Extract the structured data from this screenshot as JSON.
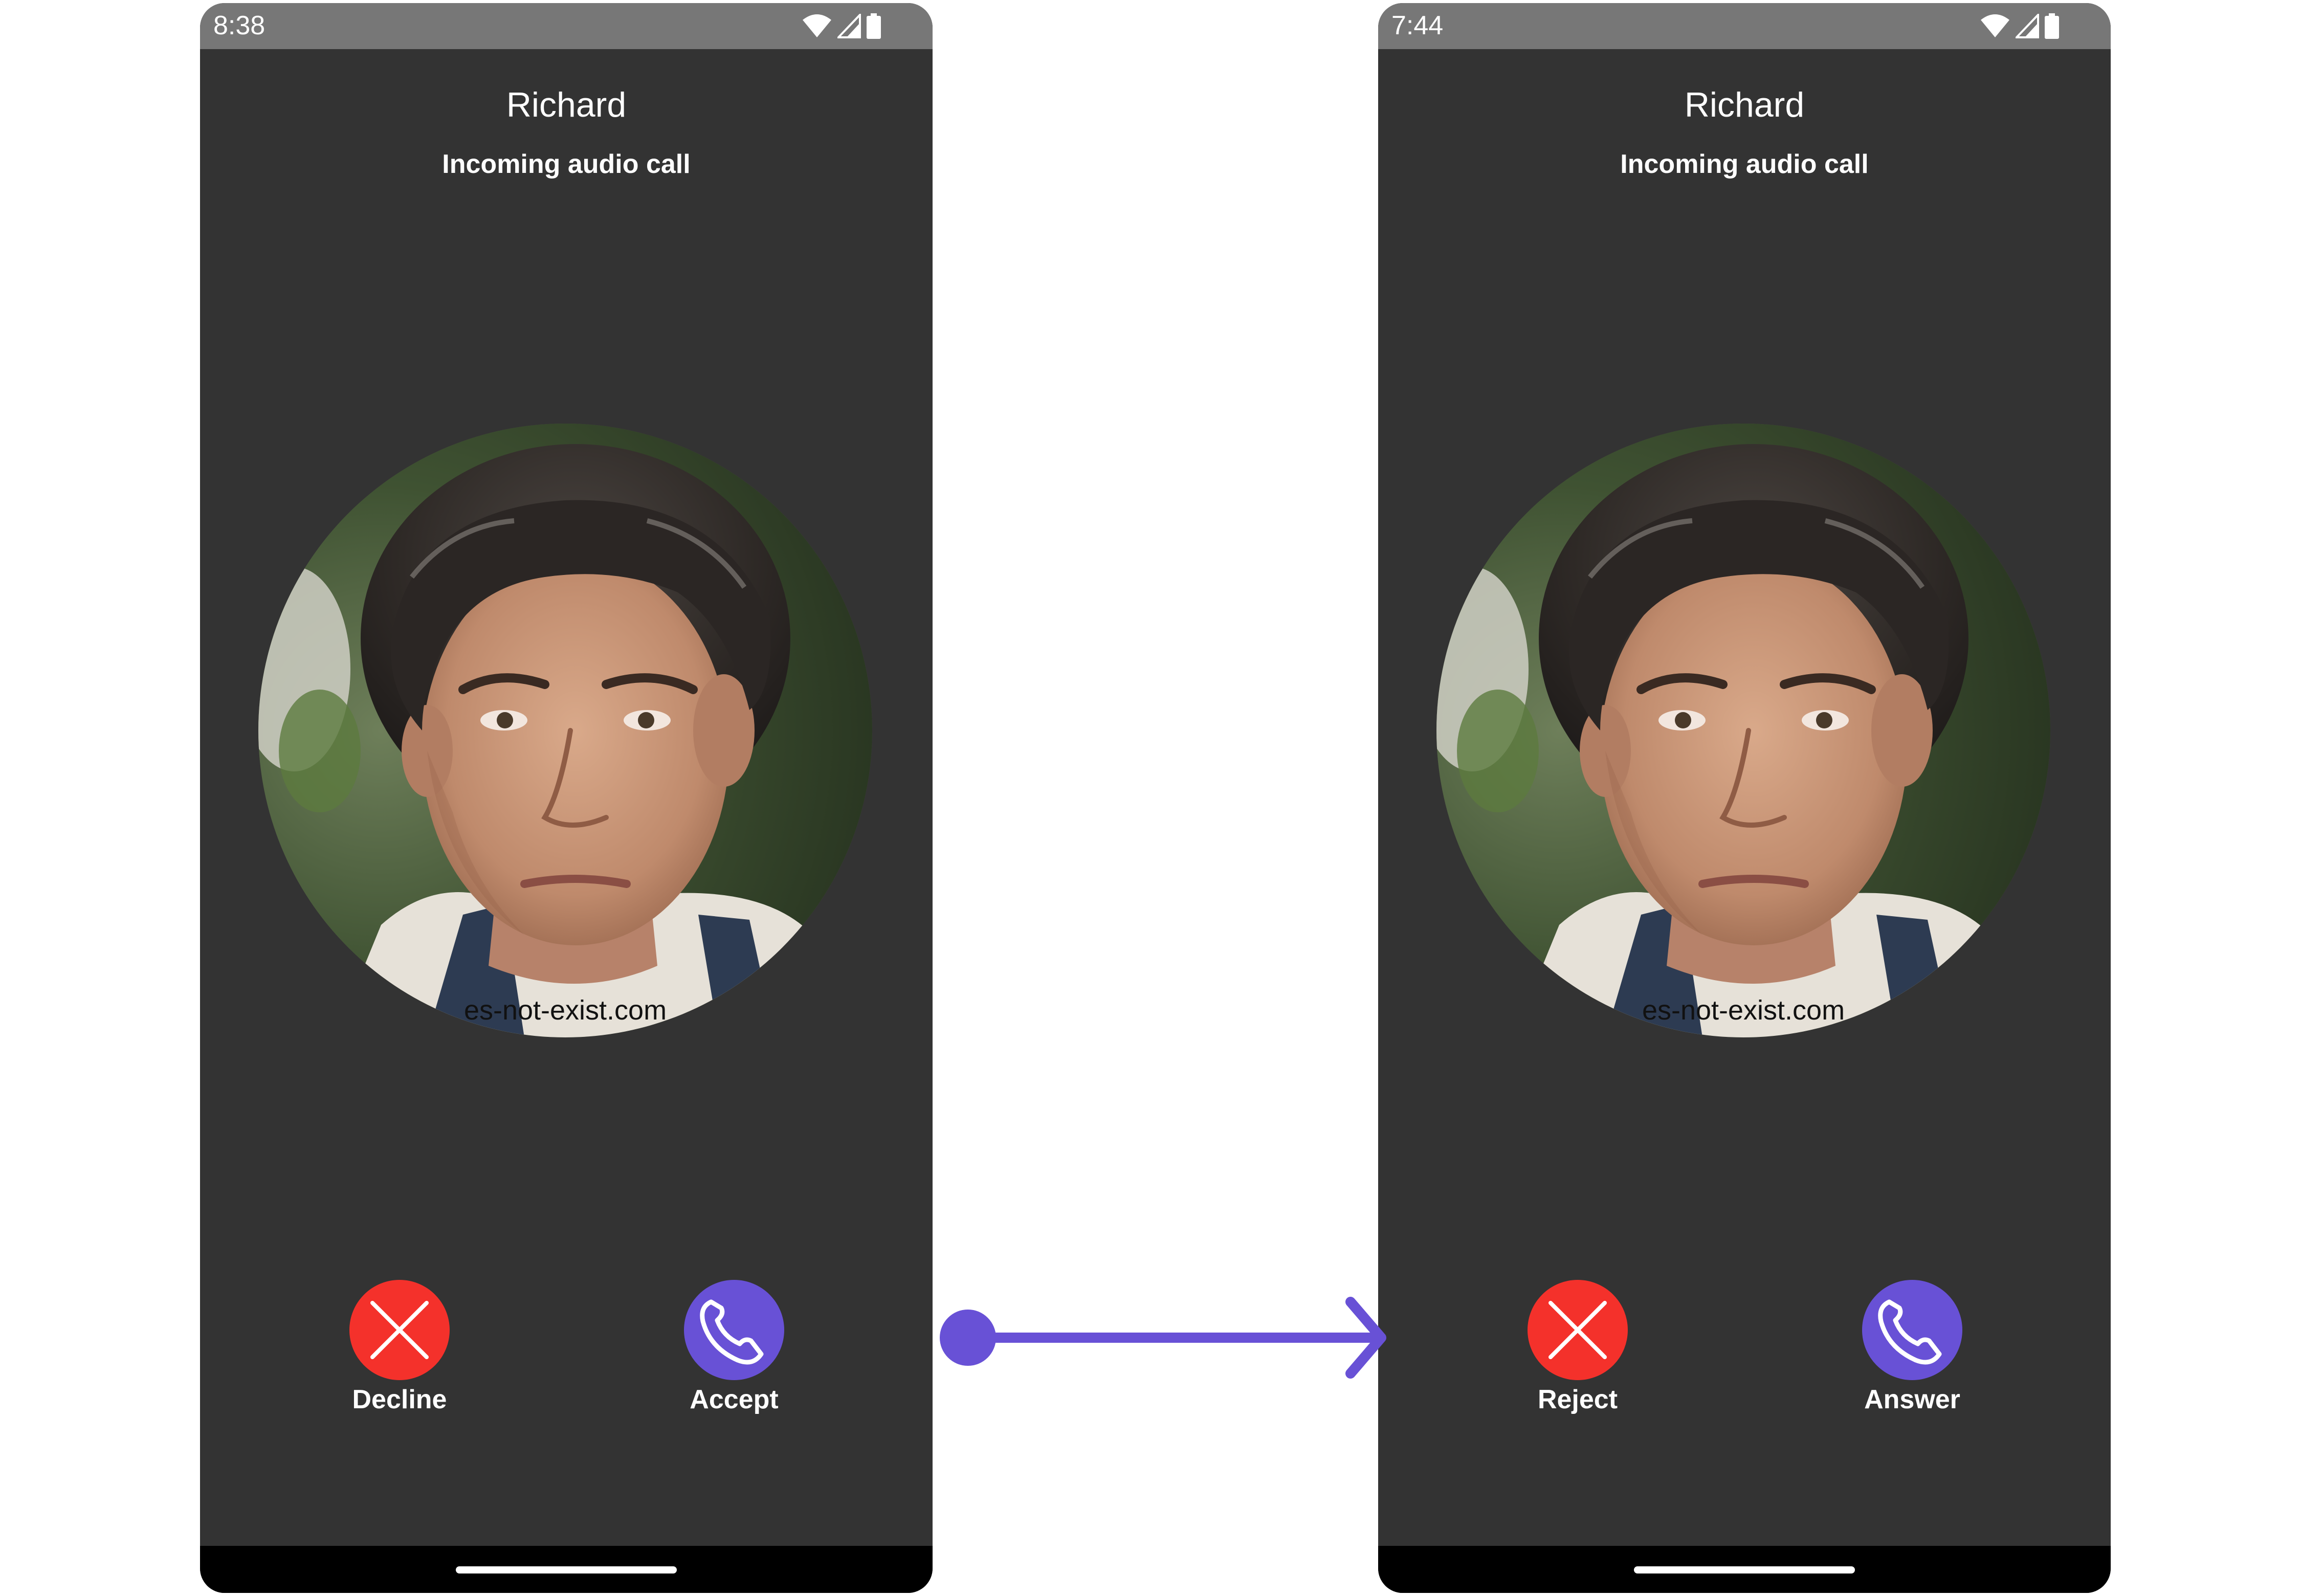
{
  "screens": [
    {
      "status_time": "8:38",
      "caller_name": "Richard",
      "call_type": "Incoming audio call",
      "avatar_watermark": "es-not-exist.com",
      "decline_label": "Decline",
      "accept_label": "Accept"
    },
    {
      "status_time": "7:44",
      "caller_name": "Richard",
      "call_type": "Incoming audio call",
      "avatar_watermark": "es-not-exist.com",
      "decline_label": "Reject",
      "accept_label": "Answer"
    }
  ],
  "icons": {
    "status": [
      "wifi-icon",
      "signal-icon",
      "battery-icon"
    ],
    "decline": "close-icon",
    "accept": "phone-icon"
  },
  "colors": {
    "screen_background": "#333333",
    "status_bar": "#777777",
    "decline": "#f4312b",
    "accept": "#6851d6",
    "connector": "#6851d6",
    "nav_bar": "#000000"
  }
}
